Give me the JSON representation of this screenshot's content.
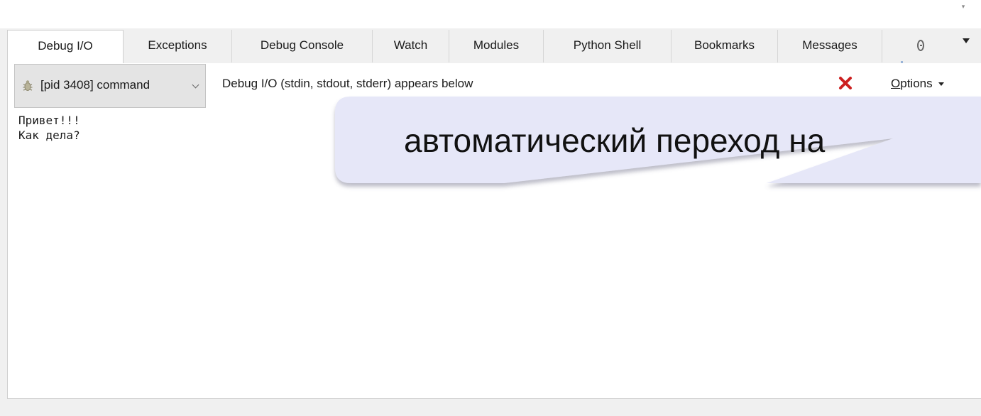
{
  "tabs": [
    {
      "label": "Debug I/O",
      "active": true
    },
    {
      "label": "Exceptions",
      "active": false
    },
    {
      "label": "Debug Console",
      "active": false
    },
    {
      "label": "Watch",
      "active": false
    },
    {
      "label": "Modules",
      "active": false
    },
    {
      "label": "Python Shell",
      "active": false
    },
    {
      "label": "Bookmarks",
      "active": false
    },
    {
      "label": "Messages",
      "active": false
    }
  ],
  "toolbar": {
    "process_select_value": "[pid 3408] command",
    "caption": "Debug I/O (stdin, stdout, stderr) appears below",
    "options_label_underlined": "O",
    "options_label_rest": "ptions"
  },
  "output": {
    "lines": [
      "Привет!!!",
      "Как дела?"
    ]
  },
  "callout": {
    "text": "автоматический переход на"
  },
  "colors": {
    "panel_background": "#ffffff",
    "chrome_background": "#f0f0f0",
    "clear_icon": "#cc1f1f",
    "callout_fill": "#e6e7f8"
  },
  "icons": {
    "process": "bug-icon",
    "clear": "close-x-icon",
    "more_tabs": "clock-icon"
  }
}
